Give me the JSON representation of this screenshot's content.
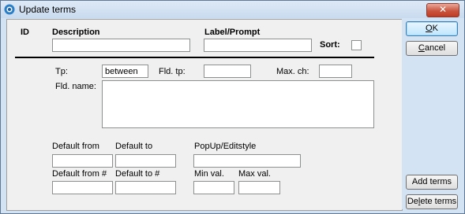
{
  "window": {
    "title": "Update terms",
    "close_glyph": "✕",
    "icon": "app-icon"
  },
  "header": {
    "id_label": "ID",
    "description_label": "Description",
    "label_prompt_label": "Label/Prompt",
    "sort_label": "Sort:"
  },
  "fields": {
    "description": "",
    "label_prompt": "",
    "tp_label": "Tp:",
    "tp_value": "between",
    "fld_tp_label": "Fld. tp:",
    "fld_tp_value": "",
    "max_ch_label": "Max. ch:",
    "max_ch_value": "",
    "fld_name_label": "Fld. name:",
    "fld_name_value": "",
    "default_from_label": "Default from",
    "default_from_value": "",
    "default_to_label": "Default to",
    "default_to_value": "",
    "popup_label": "PopUp/Editstyle",
    "popup_value": "",
    "default_from_num_label": "Default from #",
    "default_from_num_value": "",
    "default_to_num_label": "Default to #",
    "default_to_num_value": "",
    "min_val_label": "Min val.",
    "min_val_value": "",
    "max_val_label": "Max val.",
    "max_val_value": ""
  },
  "buttons": {
    "ok_accel": "O",
    "ok_rest": "K",
    "cancel_accel": "C",
    "cancel_rest": "ancel",
    "add_terms": "Add terms",
    "delete_pre": "De",
    "delete_accel": "l",
    "delete_post": "ete terms"
  }
}
